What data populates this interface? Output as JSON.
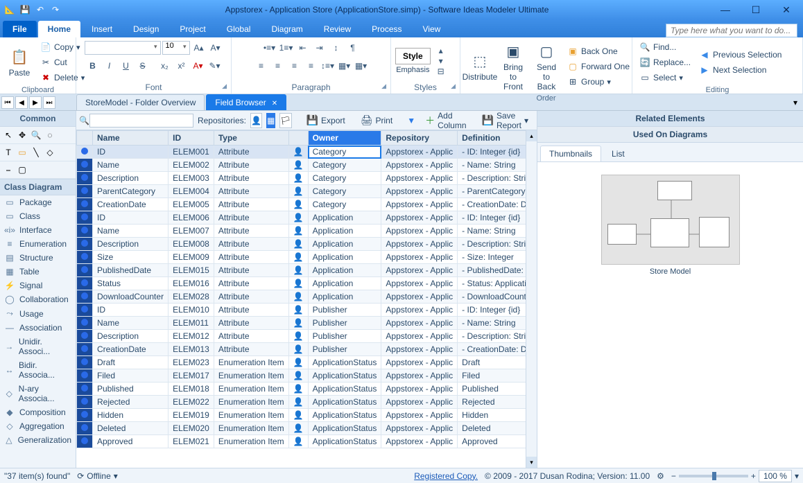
{
  "title": "Appstorex - Application Store (ApplicationStore.simp)  -  Software Ideas Modeler Ultimate",
  "search_placeholder": "Type here what you want to do...",
  "menu": {
    "file": "File",
    "home": "Home",
    "insert": "Insert",
    "design": "Design",
    "project": "Project",
    "global": "Global",
    "diagram": "Diagram",
    "review": "Review",
    "process": "Process",
    "view": "View"
  },
  "ribbon": {
    "clipboard": {
      "paste": "Paste",
      "copy": "Copy",
      "cut": "Cut",
      "delete": "Delete",
      "label": "Clipboard"
    },
    "font": {
      "size": "10",
      "label": "Font"
    },
    "paragraph": {
      "label": "Paragraph"
    },
    "styles": {
      "style": "Style",
      "emphasis": "Emphasis",
      "label": "Styles"
    },
    "order": {
      "distribute": "Distribute",
      "bringfront": "Bring to\nFront",
      "sendback": "Send to\nBack",
      "backone": "Back One",
      "forwardone": "Forward One",
      "group": "Group",
      "label": "Order"
    },
    "editing": {
      "find": "Find...",
      "replace": "Replace...",
      "select": "Select",
      "prevsel": "Previous Selection",
      "nextsel": "Next Selection",
      "label": "Editing"
    }
  },
  "doctabs": {
    "tab1": "StoreModel - Folder Overview",
    "tab2": "Field Browser"
  },
  "sidebar": {
    "common": "Common",
    "classdiag": "Class Diagram",
    "items": [
      "Package",
      "Class",
      "Interface",
      "Enumeration",
      "Structure",
      "Table",
      "Signal",
      "Collaboration",
      "Usage",
      "Association",
      "Unidir. Associ...",
      "Bidir. Associa...",
      "N-ary Associa...",
      "Composition",
      "Aggregation",
      "Generalization"
    ]
  },
  "toolbar": {
    "repositories": "Repositories:",
    "export": "Export",
    "print": "Print",
    "addcol": "Add Column",
    "savereport": "Save Report"
  },
  "grid": {
    "headers": [
      "Name",
      "ID",
      "Type",
      "Owner",
      "Repository",
      "Definition"
    ],
    "rows": [
      {
        "name": "ID",
        "id": "ELEM001",
        "type": "Attribute",
        "owner": "Category",
        "repo": "Appstorex - Applic",
        "def": "- ID: Integer {id}",
        "sel": true
      },
      {
        "name": "Name",
        "id": "ELEM002",
        "type": "Attribute",
        "owner": "Category",
        "repo": "Appstorex - Applic",
        "def": "- Name: String"
      },
      {
        "name": "Description",
        "id": "ELEM003",
        "type": "Attribute",
        "owner": "Category",
        "repo": "Appstorex - Applic",
        "def": "- Description: Strin"
      },
      {
        "name": "ParentCategory",
        "id": "ELEM004",
        "type": "Attribute",
        "owner": "Category",
        "repo": "Appstorex - Applic",
        "def": "- ParentCategory:"
      },
      {
        "name": "CreationDate",
        "id": "ELEM005",
        "type": "Attribute",
        "owner": "Category",
        "repo": "Appstorex - Applic",
        "def": "- CreationDate: Da"
      },
      {
        "name": "ID",
        "id": "ELEM006",
        "type": "Attribute",
        "owner": "Application",
        "repo": "Appstorex - Applic",
        "def": "- ID: Integer {id}"
      },
      {
        "name": "Name",
        "id": "ELEM007",
        "type": "Attribute",
        "owner": "Application",
        "repo": "Appstorex - Applic",
        "def": "- Name: String"
      },
      {
        "name": "Description",
        "id": "ELEM008",
        "type": "Attribute",
        "owner": "Application",
        "repo": "Appstorex - Applic",
        "def": "- Description: Strin"
      },
      {
        "name": "Size",
        "id": "ELEM009",
        "type": "Attribute",
        "owner": "Application",
        "repo": "Appstorex - Applic",
        "def": "- Size: Integer"
      },
      {
        "name": "PublishedDate",
        "id": "ELEM015",
        "type": "Attribute",
        "owner": "Application",
        "repo": "Appstorex - Applic",
        "def": "- PublishedDate: D"
      },
      {
        "name": "Status",
        "id": "ELEM016",
        "type": "Attribute",
        "owner": "Application",
        "repo": "Appstorex - Applic",
        "def": "- Status: Applicatio"
      },
      {
        "name": "DownloadCounter",
        "id": "ELEM028",
        "type": "Attribute",
        "owner": "Application",
        "repo": "Appstorex - Applic",
        "def": "- DownloadCounte"
      },
      {
        "name": "ID",
        "id": "ELEM010",
        "type": "Attribute",
        "owner": "Publisher",
        "repo": "Appstorex - Applic",
        "def": "- ID: Integer {id}"
      },
      {
        "name": "Name",
        "id": "ELEM011",
        "type": "Attribute",
        "owner": "Publisher",
        "repo": "Appstorex - Applic",
        "def": "- Name: String"
      },
      {
        "name": "Description",
        "id": "ELEM012",
        "type": "Attribute",
        "owner": "Publisher",
        "repo": "Appstorex - Applic",
        "def": "- Description: Strin"
      },
      {
        "name": "CreationDate",
        "id": "ELEM013",
        "type": "Attribute",
        "owner": "Publisher",
        "repo": "Appstorex - Applic",
        "def": "- CreationDate: Da"
      },
      {
        "name": "Draft",
        "id": "ELEM023",
        "type": "Enumeration Item",
        "owner": "ApplicationStatus",
        "repo": "Appstorex - Applic",
        "def": "Draft"
      },
      {
        "name": "Filed",
        "id": "ELEM017",
        "type": "Enumeration Item",
        "owner": "ApplicationStatus",
        "repo": "Appstorex - Applic",
        "def": "Filed"
      },
      {
        "name": "Published",
        "id": "ELEM018",
        "type": "Enumeration Item",
        "owner": "ApplicationStatus",
        "repo": "Appstorex - Applic",
        "def": "Published"
      },
      {
        "name": "Rejected",
        "id": "ELEM022",
        "type": "Enumeration Item",
        "owner": "ApplicationStatus",
        "repo": "Appstorex - Applic",
        "def": "Rejected"
      },
      {
        "name": "Hidden",
        "id": "ELEM019",
        "type": "Enumeration Item",
        "owner": "ApplicationStatus",
        "repo": "Appstorex - Applic",
        "def": "Hidden"
      },
      {
        "name": "Deleted",
        "id": "ELEM020",
        "type": "Enumeration Item",
        "owner": "ApplicationStatus",
        "repo": "Appstorex - Applic",
        "def": "Deleted"
      },
      {
        "name": "Approved",
        "id": "ELEM021",
        "type": "Enumeration Item",
        "owner": "ApplicationStatus",
        "repo": "Appstorex - Applic",
        "def": "Approved"
      }
    ]
  },
  "rightpanel": {
    "related": "Related Elements",
    "usedon": "Used On Diagrams",
    "thumbtab": "Thumbnails",
    "listtab": "List",
    "caption": "Store Model"
  },
  "status": {
    "count": "\"37 item(s) found\"",
    "offline": "Offline",
    "registered": "Registered Copy.",
    "copyright": "© 2009 - 2017 Dusan Rodina; Version: 11.00",
    "zoom": "100 %"
  }
}
